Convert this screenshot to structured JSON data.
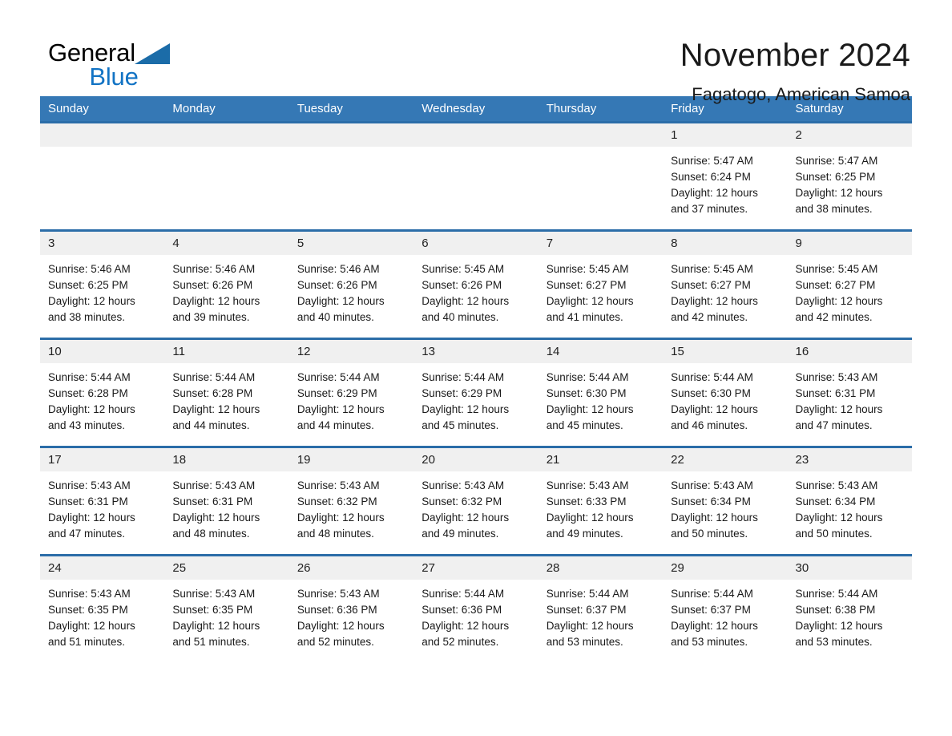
{
  "brand": {
    "word1": "General",
    "word2": "Blue",
    "triangle_color": "#1b6ca8",
    "blue_color": "#1273c4"
  },
  "header": {
    "title": "November 2024",
    "subtitle": "Fagatogo, American Samoa"
  },
  "theme": {
    "header_blue": "#3578b5",
    "row_divider_blue": "#2b6da8",
    "daynum_bg": "#f0f0f0"
  },
  "weekday_headers": [
    "Sunday",
    "Monday",
    "Tuesday",
    "Wednesday",
    "Thursday",
    "Friday",
    "Saturday"
  ],
  "weeks": [
    [
      {
        "day": "",
        "lines": []
      },
      {
        "day": "",
        "lines": []
      },
      {
        "day": "",
        "lines": []
      },
      {
        "day": "",
        "lines": []
      },
      {
        "day": "",
        "lines": []
      },
      {
        "day": "1",
        "lines": [
          "Sunrise: 5:47 AM",
          "Sunset: 6:24 PM",
          "Daylight: 12 hours",
          "and 37 minutes."
        ]
      },
      {
        "day": "2",
        "lines": [
          "Sunrise: 5:47 AM",
          "Sunset: 6:25 PM",
          "Daylight: 12 hours",
          "and 38 minutes."
        ]
      }
    ],
    [
      {
        "day": "3",
        "lines": [
          "Sunrise: 5:46 AM",
          "Sunset: 6:25 PM",
          "Daylight: 12 hours",
          "and 38 minutes."
        ]
      },
      {
        "day": "4",
        "lines": [
          "Sunrise: 5:46 AM",
          "Sunset: 6:26 PM",
          "Daylight: 12 hours",
          "and 39 minutes."
        ]
      },
      {
        "day": "5",
        "lines": [
          "Sunrise: 5:46 AM",
          "Sunset: 6:26 PM",
          "Daylight: 12 hours",
          "and 40 minutes."
        ]
      },
      {
        "day": "6",
        "lines": [
          "Sunrise: 5:45 AM",
          "Sunset: 6:26 PM",
          "Daylight: 12 hours",
          "and 40 minutes."
        ]
      },
      {
        "day": "7",
        "lines": [
          "Sunrise: 5:45 AM",
          "Sunset: 6:27 PM",
          "Daylight: 12 hours",
          "and 41 minutes."
        ]
      },
      {
        "day": "8",
        "lines": [
          "Sunrise: 5:45 AM",
          "Sunset: 6:27 PM",
          "Daylight: 12 hours",
          "and 42 minutes."
        ]
      },
      {
        "day": "9",
        "lines": [
          "Sunrise: 5:45 AM",
          "Sunset: 6:27 PM",
          "Daylight: 12 hours",
          "and 42 minutes."
        ]
      }
    ],
    [
      {
        "day": "10",
        "lines": [
          "Sunrise: 5:44 AM",
          "Sunset: 6:28 PM",
          "Daylight: 12 hours",
          "and 43 minutes."
        ]
      },
      {
        "day": "11",
        "lines": [
          "Sunrise: 5:44 AM",
          "Sunset: 6:28 PM",
          "Daylight: 12 hours",
          "and 44 minutes."
        ]
      },
      {
        "day": "12",
        "lines": [
          "Sunrise: 5:44 AM",
          "Sunset: 6:29 PM",
          "Daylight: 12 hours",
          "and 44 minutes."
        ]
      },
      {
        "day": "13",
        "lines": [
          "Sunrise: 5:44 AM",
          "Sunset: 6:29 PM",
          "Daylight: 12 hours",
          "and 45 minutes."
        ]
      },
      {
        "day": "14",
        "lines": [
          "Sunrise: 5:44 AM",
          "Sunset: 6:30 PM",
          "Daylight: 12 hours",
          "and 45 minutes."
        ]
      },
      {
        "day": "15",
        "lines": [
          "Sunrise: 5:44 AM",
          "Sunset: 6:30 PM",
          "Daylight: 12 hours",
          "and 46 minutes."
        ]
      },
      {
        "day": "16",
        "lines": [
          "Sunrise: 5:43 AM",
          "Sunset: 6:31 PM",
          "Daylight: 12 hours",
          "and 47 minutes."
        ]
      }
    ],
    [
      {
        "day": "17",
        "lines": [
          "Sunrise: 5:43 AM",
          "Sunset: 6:31 PM",
          "Daylight: 12 hours",
          "and 47 minutes."
        ]
      },
      {
        "day": "18",
        "lines": [
          "Sunrise: 5:43 AM",
          "Sunset: 6:31 PM",
          "Daylight: 12 hours",
          "and 48 minutes."
        ]
      },
      {
        "day": "19",
        "lines": [
          "Sunrise: 5:43 AM",
          "Sunset: 6:32 PM",
          "Daylight: 12 hours",
          "and 48 minutes."
        ]
      },
      {
        "day": "20",
        "lines": [
          "Sunrise: 5:43 AM",
          "Sunset: 6:32 PM",
          "Daylight: 12 hours",
          "and 49 minutes."
        ]
      },
      {
        "day": "21",
        "lines": [
          "Sunrise: 5:43 AM",
          "Sunset: 6:33 PM",
          "Daylight: 12 hours",
          "and 49 minutes."
        ]
      },
      {
        "day": "22",
        "lines": [
          "Sunrise: 5:43 AM",
          "Sunset: 6:34 PM",
          "Daylight: 12 hours",
          "and 50 minutes."
        ]
      },
      {
        "day": "23",
        "lines": [
          "Sunrise: 5:43 AM",
          "Sunset: 6:34 PM",
          "Daylight: 12 hours",
          "and 50 minutes."
        ]
      }
    ],
    [
      {
        "day": "24",
        "lines": [
          "Sunrise: 5:43 AM",
          "Sunset: 6:35 PM",
          "Daylight: 12 hours",
          "and 51 minutes."
        ]
      },
      {
        "day": "25",
        "lines": [
          "Sunrise: 5:43 AM",
          "Sunset: 6:35 PM",
          "Daylight: 12 hours",
          "and 51 minutes."
        ]
      },
      {
        "day": "26",
        "lines": [
          "Sunrise: 5:43 AM",
          "Sunset: 6:36 PM",
          "Daylight: 12 hours",
          "and 52 minutes."
        ]
      },
      {
        "day": "27",
        "lines": [
          "Sunrise: 5:44 AM",
          "Sunset: 6:36 PM",
          "Daylight: 12 hours",
          "and 52 minutes."
        ]
      },
      {
        "day": "28",
        "lines": [
          "Sunrise: 5:44 AM",
          "Sunset: 6:37 PM",
          "Daylight: 12 hours",
          "and 53 minutes."
        ]
      },
      {
        "day": "29",
        "lines": [
          "Sunrise: 5:44 AM",
          "Sunset: 6:37 PM",
          "Daylight: 12 hours",
          "and 53 minutes."
        ]
      },
      {
        "day": "30",
        "lines": [
          "Sunrise: 5:44 AM",
          "Sunset: 6:38 PM",
          "Daylight: 12 hours",
          "and 53 minutes."
        ]
      }
    ]
  ]
}
